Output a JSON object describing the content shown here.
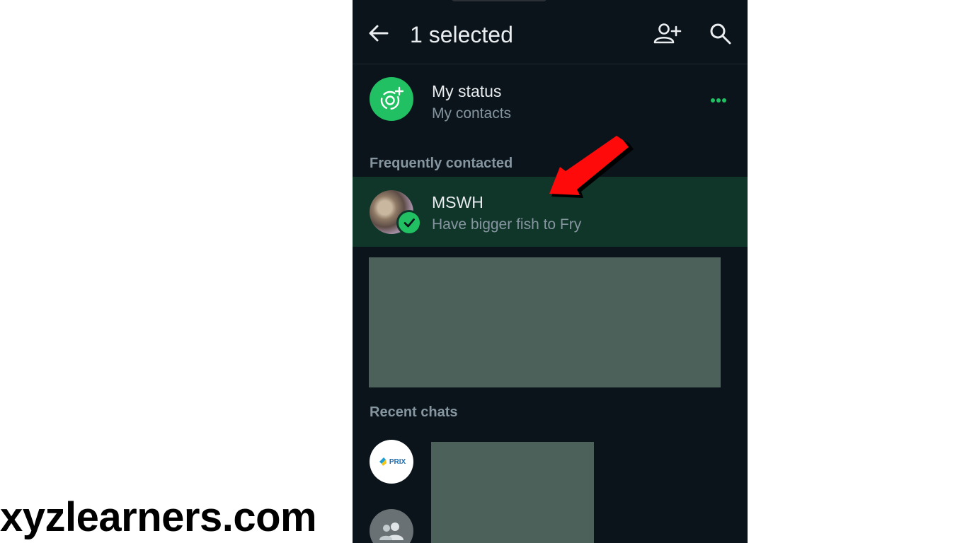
{
  "header": {
    "title": "1 selected"
  },
  "status": {
    "name": "My status",
    "sub": "My contacts"
  },
  "sections": {
    "frequent": "Frequently contacted",
    "recent": "Recent chats"
  },
  "contact": {
    "name": "MSWH",
    "sub": "Have bigger fish to Fry"
  },
  "recent": {
    "first_avatar_text": "PRIX"
  },
  "watermark": "xyzlearners.com",
  "icons": [
    "back-arrow-icon",
    "add-contact-icon",
    "search-icon",
    "status-icon",
    "more-dots-icon",
    "check-icon",
    "group-icon",
    "red-arrow-icon"
  ],
  "colors": {
    "background": "#0b141a",
    "accent": "#21c063",
    "selected_row": "#103529",
    "text_primary": "#e9edef",
    "text_secondary": "#8696a0",
    "redaction": "#4b615a",
    "annotation_arrow": "#ff0000"
  }
}
